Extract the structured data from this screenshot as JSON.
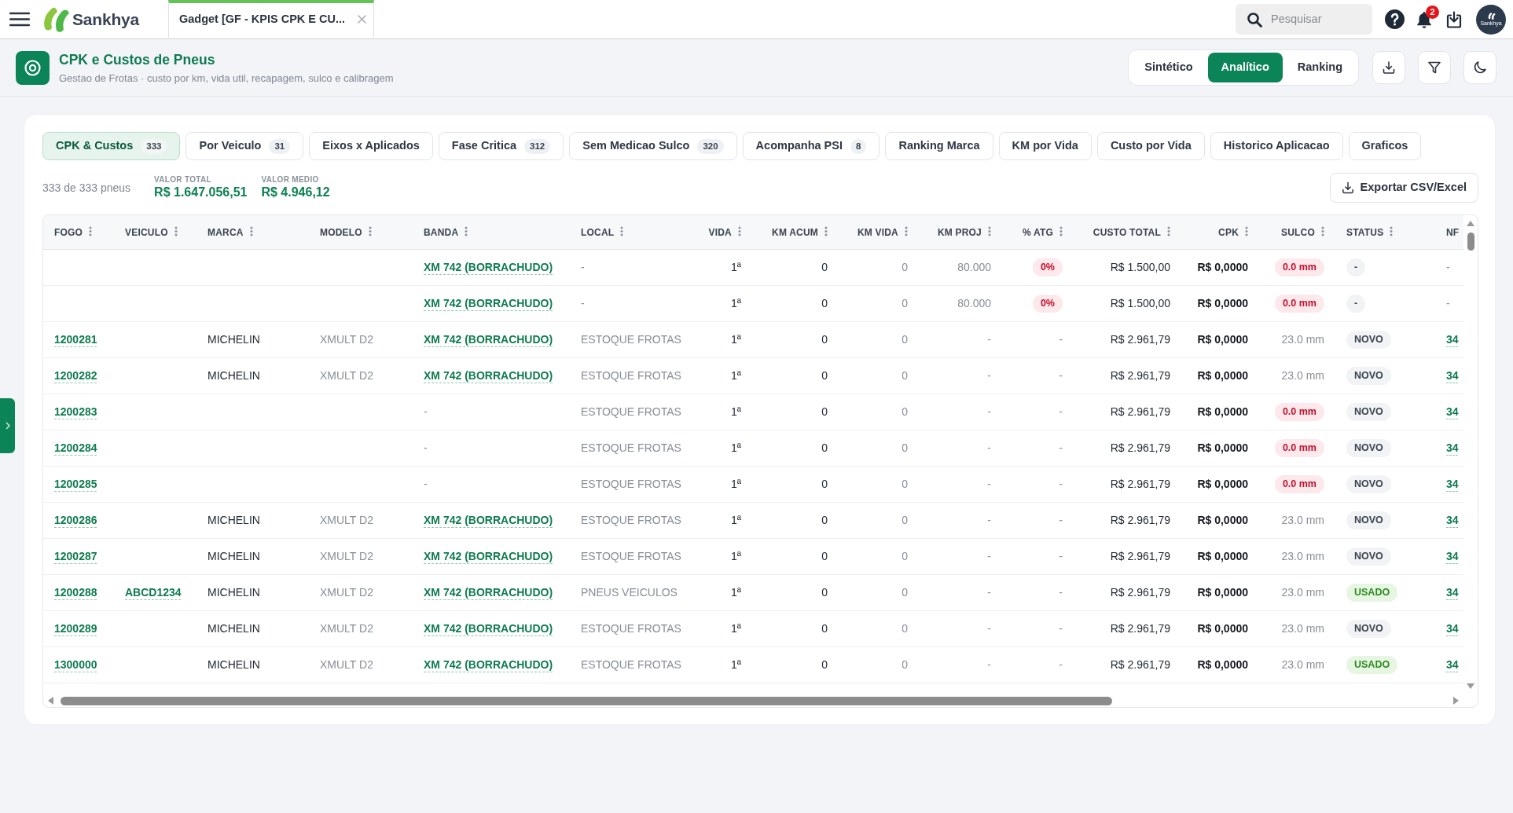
{
  "top_bar": {
    "logo_text": "Sankhya",
    "app_tab": {
      "title": "Gadget [GF - KPIS CPK E CU...",
      "selected": true
    },
    "search": {
      "placeholder": "Pesquisar"
    },
    "notification_count": "2",
    "avatar": {
      "label": "Sankhya"
    }
  },
  "page_header": {
    "title": "CPK e Custos de Pneus",
    "subtitle": "Gestao de Frotas · custo por km, vida util, recapagem, sulco e calibragem",
    "views": [
      {
        "label": "Sintético",
        "selected": false
      },
      {
        "label": "Analítico",
        "selected": true
      },
      {
        "label": "Ranking",
        "selected": false
      }
    ]
  },
  "tabs": [
    {
      "label": "CPK & Custos",
      "count": "333",
      "selected": true
    },
    {
      "label": "Por Veiculo",
      "count": "31",
      "selected": false
    },
    {
      "label": "Eixos x Aplicados",
      "selected": false
    },
    {
      "label": "Fase Critica",
      "count": "312",
      "selected": false
    },
    {
      "label": "Sem Medicao Sulco",
      "count": "320",
      "selected": false
    },
    {
      "label": "Acompanha PSI",
      "count": "8",
      "selected": false
    },
    {
      "label": "Ranking Marca",
      "selected": false
    },
    {
      "label": "KM por Vida",
      "selected": false
    },
    {
      "label": "Custo por Vida",
      "selected": false
    },
    {
      "label": "Historico Aplicacao",
      "selected": false
    },
    {
      "label": "Graficos",
      "selected": false
    }
  ],
  "summary": {
    "count_text": "333 de 333 pneus",
    "stats": [
      {
        "label": "VALOR TOTAL",
        "value": "R$ 1.647.056,51"
      },
      {
        "label": "VALOR MEDIO",
        "value": "R$ 4.946,12"
      }
    ],
    "export_label": "Exportar CSV/Excel"
  },
  "table": {
    "columns": [
      {
        "label": "FOGO",
        "kind": "link",
        "menu": true
      },
      {
        "label": "VEICULO",
        "kind": "link",
        "menu": true
      },
      {
        "label": "MARCA",
        "kind": "text",
        "menu": true
      },
      {
        "label": "MODELO",
        "kind": "muted",
        "menu": true
      },
      {
        "label": "BANDA",
        "kind": "link",
        "menu": true
      },
      {
        "label": "LOCAL",
        "kind": "muted",
        "menu": true
      },
      {
        "label": "VIDA",
        "kind": "number",
        "menu": true
      },
      {
        "label": "KM ACUM",
        "kind": "number",
        "menu": true
      },
      {
        "label": "KM VIDA",
        "kind": "number-muted",
        "menu": true
      },
      {
        "label": "KM PROJ",
        "kind": "number-muted",
        "menu": true
      },
      {
        "label": "% ATG",
        "kind": "number-muted",
        "menu": true
      },
      {
        "label": "CUSTO TOTAL",
        "kind": "number",
        "menu": true
      },
      {
        "label": "CPK",
        "kind": "number-strong",
        "menu": true
      },
      {
        "label": "SULCO",
        "kind": "number-muted",
        "menu": true
      },
      {
        "label": "STATUS",
        "kind": "badge-neutral",
        "menu": true
      },
      {
        "label": "NF",
        "kind": "link",
        "menu": false
      }
    ],
    "rows": [
      {
        "cells": [
          {
            "kind": "blank"
          },
          {
            "kind": "blank"
          },
          {
            "kind": "blank"
          },
          {
            "kind": "blank"
          },
          "XM 742 (BORRACHUDO)",
          "-",
          "1ª",
          "0",
          "0",
          "80.000",
          {
            "text": "0%",
            "kind": "badge-danger"
          },
          "R$ 1.500,00",
          "R$ 0,0000",
          {
            "text": "0.0 mm",
            "kind": "badge-danger"
          },
          "-",
          {
            "text": "-",
            "kind": "muted"
          }
        ]
      },
      {
        "cells": [
          {
            "kind": "blank"
          },
          {
            "kind": "blank"
          },
          {
            "kind": "blank"
          },
          {
            "kind": "blank"
          },
          "XM 742 (BORRACHUDO)",
          "-",
          "1ª",
          "0",
          "0",
          "80.000",
          {
            "text": "0%",
            "kind": "badge-danger"
          },
          "R$ 1.500,00",
          "R$ 0,0000",
          {
            "text": "0.0 mm",
            "kind": "badge-danger"
          },
          "-",
          {
            "text": "-",
            "kind": "muted"
          }
        ]
      },
      {
        "cells": [
          "1200281",
          {
            "kind": "blank"
          },
          "MICHELIN",
          "XMULT D2",
          "XM 742 (BORRACHUDO)",
          "ESTOQUE FROTAS",
          "1ª",
          "0",
          "0",
          "-",
          "-",
          "R$ 2.961,79",
          "R$ 0,0000",
          "23.0 mm",
          "NOVO",
          "34"
        ]
      },
      {
        "cells": [
          "1200282",
          {
            "kind": "blank"
          },
          "MICHELIN",
          "XMULT D2",
          "XM 742 (BORRACHUDO)",
          "ESTOQUE FROTAS",
          "1ª",
          "0",
          "0",
          "-",
          "-",
          "R$ 2.961,79",
          "R$ 0,0000",
          "23.0 mm",
          "NOVO",
          "34"
        ]
      },
      {
        "cells": [
          "1200283",
          {
            "kind": "blank"
          },
          {
            "kind": "blank"
          },
          {
            "kind": "blank"
          },
          {
            "text": "-",
            "kind": "muted"
          },
          "ESTOQUE FROTAS",
          "1ª",
          "0",
          "0",
          "-",
          "-",
          "R$ 2.961,79",
          "R$ 0,0000",
          {
            "text": "0.0 mm",
            "kind": "badge-danger"
          },
          "NOVO",
          "34"
        ]
      },
      {
        "cells": [
          "1200284",
          {
            "kind": "blank"
          },
          {
            "kind": "blank"
          },
          {
            "kind": "blank"
          },
          {
            "text": "-",
            "kind": "muted"
          },
          "ESTOQUE FROTAS",
          "1ª",
          "0",
          "0",
          "-",
          "-",
          "R$ 2.961,79",
          "R$ 0,0000",
          {
            "text": "0.0 mm",
            "kind": "badge-danger"
          },
          "NOVO",
          "34"
        ]
      },
      {
        "cells": [
          "1200285",
          {
            "kind": "blank"
          },
          {
            "kind": "blank"
          },
          {
            "kind": "blank"
          },
          {
            "text": "-",
            "kind": "muted"
          },
          "ESTOQUE FROTAS",
          "1ª",
          "0",
          "0",
          "-",
          "-",
          "R$ 2.961,79",
          "R$ 0,0000",
          {
            "text": "0.0 mm",
            "kind": "badge-danger"
          },
          "NOVO",
          "34"
        ]
      },
      {
        "cells": [
          "1200286",
          {
            "kind": "blank"
          },
          "MICHELIN",
          "XMULT D2",
          "XM 742 (BORRACHUDO)",
          "ESTOQUE FROTAS",
          "1ª",
          "0",
          "0",
          "-",
          "-",
          "R$ 2.961,79",
          "R$ 0,0000",
          "23.0 mm",
          "NOVO",
          "34"
        ]
      },
      {
        "cells": [
          "1200287",
          {
            "kind": "blank"
          },
          "MICHELIN",
          "XMULT D2",
          "XM 742 (BORRACHUDO)",
          "ESTOQUE FROTAS",
          "1ª",
          "0",
          "0",
          "-",
          "-",
          "R$ 2.961,79",
          "R$ 0,0000",
          "23.0 mm",
          "NOVO",
          "34"
        ]
      },
      {
        "cells": [
          "1200288",
          "ABCD1234",
          "MICHELIN",
          "XMULT D2",
          "XM 742 (BORRACHUDO)",
          "PNEUS VEICULOS",
          "1ª",
          "0",
          "0",
          "-",
          "-",
          "R$ 2.961,79",
          "R$ 0,0000",
          "23.0 mm",
          {
            "text": "USADO",
            "kind": "badge-success"
          },
          "34"
        ]
      },
      {
        "cells": [
          "1200289",
          {
            "kind": "blank"
          },
          "MICHELIN",
          "XMULT D2",
          "XM 742 (BORRACHUDO)",
          "ESTOQUE FROTAS",
          "1ª",
          "0",
          "0",
          "-",
          "-",
          "R$ 2.961,79",
          "R$ 0,0000",
          "23.0 mm",
          "NOVO",
          "34"
        ]
      },
      {
        "cells": [
          "1300000",
          {
            "kind": "blank"
          },
          "MICHELIN",
          "XMULT D2",
          "XM 742 (BORRACHUDO)",
          "ESTOQUE FROTAS",
          "1ª",
          "0",
          "0",
          "-",
          "-",
          "R$ 2.961,79",
          "R$ 0,0000",
          "23.0 mm",
          {
            "text": "USADO",
            "kind": "badge-success"
          },
          "34"
        ]
      }
    ]
  }
}
